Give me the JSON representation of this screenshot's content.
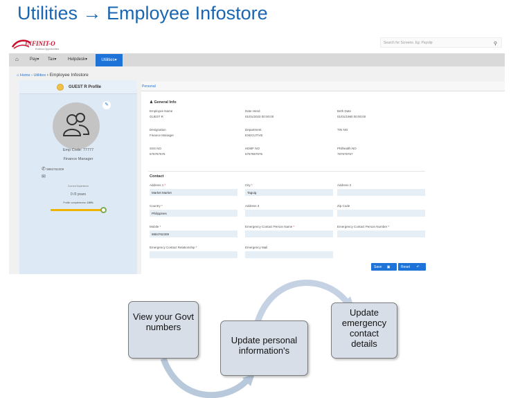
{
  "slide_title": "Utilities → Employee Infostore",
  "app": {
    "logo_text": "INFINIT-O",
    "logo_subtext": "Endless Opportunities",
    "search_placeholder": "Search for Screens. Eg: Payslip",
    "nav": [
      "Pay",
      "Tax",
      "Helpdesk",
      "Utilities"
    ],
    "active_nav": "Utilities"
  },
  "breadcrumb": {
    "home": "Home",
    "section": "Utilities",
    "current": "Employee Infostore"
  },
  "profile": {
    "title": "GUEST R Profile",
    "emp_code": "Emp Code: 77777",
    "designation": "Finance Manager",
    "phone": "9884762309",
    "experience_label": "Current Experience",
    "experience_value": "0 /0 years",
    "completeness_label": "Profile completeness:",
    "completeness_value": "100%",
    "completeness_fraction": 1.0
  },
  "panel": {
    "tab": "Personal",
    "general_title": "General Info",
    "general": [
      {
        "label": "Employee Name",
        "value": "GUEST R"
      },
      {
        "label": "Date Hired",
        "value": "01/01/2020 00:00:00"
      },
      {
        "label": "Birth Date",
        "value": "01/01/1980 00:00:00"
      },
      {
        "label": "Designation",
        "value": "Finance Manager"
      },
      {
        "label": "Department",
        "value": "EXECUTIVE"
      },
      {
        "label": "TIN NO",
        "value": ""
      },
      {
        "label": "SSS NO",
        "value": "676767676"
      },
      {
        "label": "HDMF NO",
        "value": "6767867676"
      },
      {
        "label": "Philhealth NO",
        "value": "787678767"
      }
    ],
    "contact_title": "Contact",
    "contact": [
      {
        "label": "Address 1",
        "required": true,
        "value": "Market Market"
      },
      {
        "label": "City",
        "required": true,
        "value": "Taguig"
      },
      {
        "label": "Address 2",
        "required": false,
        "value": ""
      },
      {
        "label": "Country",
        "required": true,
        "value": "Philippines"
      },
      {
        "label": "Address 3",
        "required": false,
        "value": ""
      },
      {
        "label": "Zip Code",
        "required": false,
        "value": ""
      },
      {
        "label": "Mobile",
        "required": true,
        "value": "9884762309"
      },
      {
        "label": "Emergency Contact Person Name",
        "required": true,
        "value": ""
      },
      {
        "label": "Emergency Contact Person Number",
        "required": true,
        "value": ""
      },
      {
        "label": "Emergency Contact Relationship",
        "required": true,
        "value": ""
      },
      {
        "label": "Emergency Mail",
        "required": false,
        "value": ""
      }
    ],
    "save_label": "Save",
    "reset_label": "Reset"
  },
  "flow": [
    {
      "text": "View your Govt numbers"
    },
    {
      "text": "Update personal information's"
    },
    {
      "text": "Update emergency contact details"
    }
  ]
}
